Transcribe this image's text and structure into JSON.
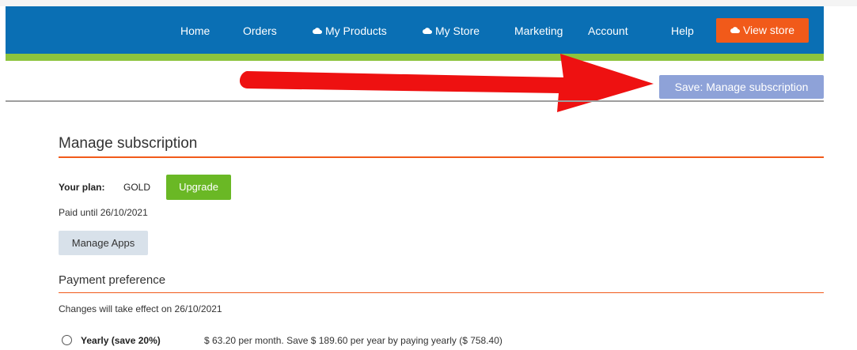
{
  "nav": {
    "items": [
      {
        "label": "Home",
        "icon": ""
      },
      {
        "label": "Orders",
        "icon": ""
      },
      {
        "label": "My Products",
        "icon": "cloud-icon"
      },
      {
        "label": "My Store",
        "icon": "cloud-icon"
      },
      {
        "label": "Marketing",
        "icon": ""
      },
      {
        "label": "Account",
        "icon": ""
      },
      {
        "label": "Help",
        "icon": ""
      }
    ],
    "view_store_label": "View store",
    "view_store_icon": "cloud-icon"
  },
  "toolbar": {
    "save_label": "Save: Manage subscription"
  },
  "main": {
    "title": "Manage subscription",
    "plan_label": "Your plan:",
    "plan_value": "GOLD",
    "upgrade_label": "Upgrade",
    "paid_until": "Paid until 26/10/2021",
    "manage_apps_label": "Manage Apps",
    "payment": {
      "title": "Payment preference",
      "changes_note": "Changes will take effect on 26/10/2021",
      "options": [
        {
          "label": "Yearly (save 20%)",
          "description": "$ 63.20 per month. Save $ 189.60 per year by paying yearly ($ 758.40)",
          "selected": false
        }
      ]
    }
  },
  "colors": {
    "nav_blue": "#0a6fb4",
    "nav_green": "#8dc43d",
    "accent_orange": "#f15a1a",
    "upgrade_green": "#6ab825",
    "save_button": "#8ea2d8",
    "arrow_red": "#ee1111"
  }
}
